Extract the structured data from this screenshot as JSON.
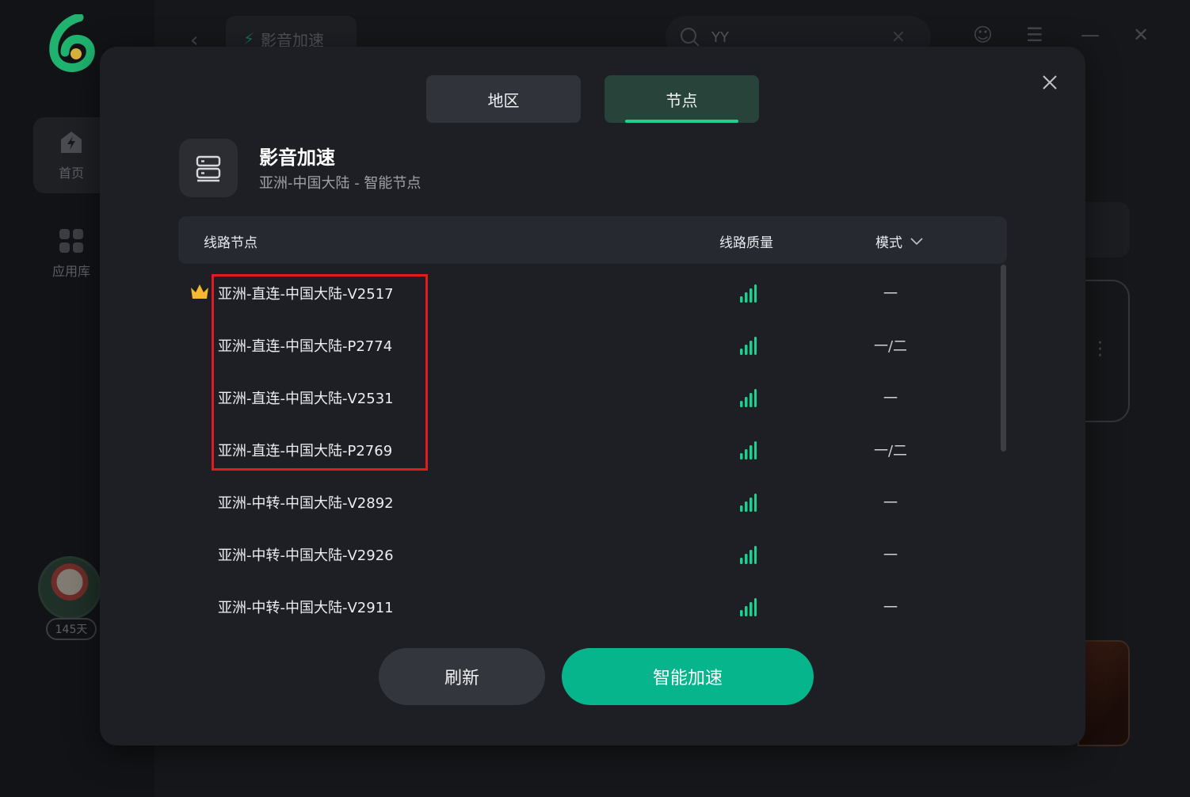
{
  "sidebar": {
    "items": [
      {
        "label": "首页",
        "icon": "lightning-house-icon"
      },
      {
        "label": "应用库",
        "icon": "apps-grid-icon"
      }
    ],
    "membership_days": "145天"
  },
  "topbar": {
    "current_tab": "影音加速",
    "search_value": "YY"
  },
  "modal": {
    "tabs": [
      {
        "label": "地区",
        "active": false
      },
      {
        "label": "节点",
        "active": true
      }
    ],
    "game": {
      "title": "影音加速",
      "subtitle": "亚洲-中国大陆 - 智能节点"
    },
    "table": {
      "headers": {
        "node": "线路节点",
        "quality": "线路质量",
        "mode": "模式"
      },
      "rows": [
        {
          "name": "亚洲-直连-中国大陆-V2517",
          "mode": "一",
          "recommended": true
        },
        {
          "name": "亚洲-直连-中国大陆-P2774",
          "mode": "一/二",
          "recommended": false
        },
        {
          "name": "亚洲-直连-中国大陆-V2531",
          "mode": "一",
          "recommended": false
        },
        {
          "name": "亚洲-直连-中国大陆-P2769",
          "mode": "一/二",
          "recommended": false
        },
        {
          "name": "亚洲-中转-中国大陆-V2892",
          "mode": "一",
          "recommended": false
        },
        {
          "name": "亚洲-中转-中国大陆-V2926",
          "mode": "一",
          "recommended": false
        },
        {
          "name": "亚洲-中转-中国大陆-V2911",
          "mode": "一",
          "recommended": false
        }
      ]
    },
    "buttons": {
      "refresh": "刷新",
      "smart": "智能加速"
    }
  },
  "colors": {
    "accent": "#07b58d",
    "signal": "#1fd18f",
    "highlight": "#e01b22",
    "crown": "#f7b731"
  }
}
